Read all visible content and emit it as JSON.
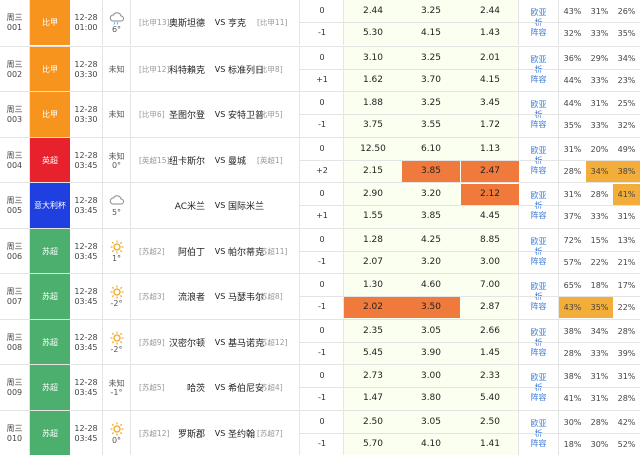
{
  "rows": [
    {
      "day": "周三",
      "num": "001",
      "league": "比甲",
      "color": "#f7941d",
      "date": "12-28",
      "time": "01:00",
      "weather_icon": "cloud-rain-icon",
      "temp": "6°",
      "home_rank": "[比甲13]",
      "home": "奥斯坦德",
      "vs": "VS",
      "away": "亨克",
      "away_rank": "[比甲11]",
      "hc": [
        "0",
        "-1"
      ],
      "odds": [
        [
          "2.44",
          "3.25",
          "2.44"
        ],
        [
          "5.30",
          "4.15",
          "1.43"
        ]
      ],
      "hl_odds": [
        [],
        []
      ],
      "links": [
        "欧",
        "亚",
        "析",
        "阵",
        "容"
      ],
      "pct": [
        [
          "43%",
          "31%",
          "26%"
        ],
        [
          "32%",
          "33%",
          "35%"
        ]
      ],
      "hl_pct": [
        [],
        []
      ]
    },
    {
      "day": "周三",
      "num": "002",
      "league": "比甲",
      "color": "#f7941d",
      "date": "12-28",
      "time": "03:30",
      "weather_icon": "",
      "weather_text": "未知",
      "home_rank": "[比甲12]",
      "home": "科特賴克",
      "vs": "VS",
      "away": "标准列日",
      "away_rank": "[比甲8]",
      "hc": [
        "0",
        "+1"
      ],
      "odds": [
        [
          "3.10",
          "3.25",
          "2.01"
        ],
        [
          "1.62",
          "3.70",
          "4.15"
        ]
      ],
      "hl_odds": [
        [],
        []
      ],
      "links": [
        "欧",
        "亚",
        "析",
        "阵",
        "容"
      ],
      "pct": [
        [
          "36%",
          "29%",
          "34%"
        ],
        [
          "44%",
          "33%",
          "23%"
        ]
      ],
      "hl_pct": [
        [],
        []
      ]
    },
    {
      "day": "周三",
      "num": "003",
      "league": "比甲",
      "color": "#f7941d",
      "date": "12-28",
      "time": "03:30",
      "weather_icon": "",
      "weather_text": "未知",
      "home_rank": "[比甲6]",
      "home": "圣图尔登",
      "vs": "VS",
      "away": "安特卫普",
      "away_rank": "[比甲5]",
      "hc": [
        "0",
        "-1"
      ],
      "odds": [
        [
          "1.88",
          "3.25",
          "3.45"
        ],
        [
          "3.75",
          "3.55",
          "1.72"
        ]
      ],
      "hl_odds": [
        [],
        []
      ],
      "links": [
        "欧",
        "亚",
        "析",
        "阵",
        "容"
      ],
      "pct": [
        [
          "44%",
          "31%",
          "25%"
        ],
        [
          "35%",
          "33%",
          "32%"
        ]
      ],
      "hl_pct": [
        [],
        []
      ]
    },
    {
      "day": "周三",
      "num": "004",
      "league": "英超",
      "color": "#e8222c",
      "date": "12-28",
      "time": "03:45",
      "weather_icon": "",
      "weather_text": "未知",
      "temp": "0°",
      "home_rank": "[英超15]",
      "home": "纽卡斯尔",
      "vs": "VS",
      "away": "曼城",
      "away_rank": "[英超1]",
      "hc": [
        "0",
        "+2"
      ],
      "odds": [
        [
          "12.50",
          "6.10",
          "1.13"
        ],
        [
          "2.15",
          "3.85",
          "2.47"
        ]
      ],
      "hl_odds": [
        [],
        [
          1,
          2
        ]
      ],
      "links": [
        "欧",
        "亚",
        "析",
        "阵",
        "容"
      ],
      "pct": [
        [
          "31%",
          "20%",
          "49%"
        ],
        [
          "28%",
          "34%",
          "38%"
        ]
      ],
      "hl_pct": [
        [],
        [
          1,
          2
        ]
      ]
    },
    {
      "day": "周三",
      "num": "005",
      "league": "意大利杯",
      "color": "#1f3fe0",
      "date": "12-28",
      "time": "03:45",
      "weather_icon": "cloud-icon",
      "temp": "5°",
      "home_rank": "",
      "home": "AC米兰",
      "vs": "VS",
      "away": "国际米兰",
      "away_rank": "",
      "hc": [
        "0",
        "+1"
      ],
      "odds": [
        [
          "2.90",
          "3.20",
          "2.12"
        ],
        [
          "1.55",
          "3.85",
          "4.45"
        ]
      ],
      "hl_odds": [
        [
          2
        ],
        []
      ],
      "links": [
        "欧",
        "亚",
        "析",
        "阵",
        "容"
      ],
      "pct": [
        [
          "31%",
          "28%",
          "41%"
        ],
        [
          "37%",
          "33%",
          "31%"
        ]
      ],
      "hl_pct": [
        [
          2
        ],
        []
      ]
    },
    {
      "day": "周三",
      "num": "006",
      "league": "苏超",
      "color": "#4caf6e",
      "date": "12-28",
      "time": "03:45",
      "weather_icon": "sun-icon",
      "temp": "1°",
      "home_rank": "[苏超2]",
      "home": "阿伯丁",
      "vs": "VS",
      "away": "帕尔蒂克",
      "away_rank": "[苏超11]",
      "hc": [
        "0",
        "-1"
      ],
      "odds": [
        [
          "1.28",
          "4.25",
          "8.85"
        ],
        [
          "2.07",
          "3.20",
          "3.00"
        ]
      ],
      "hl_odds": [
        [],
        []
      ],
      "links": [
        "欧",
        "亚",
        "析",
        "阵",
        "容"
      ],
      "pct": [
        [
          "72%",
          "15%",
          "13%"
        ],
        [
          "57%",
          "22%",
          "21%"
        ]
      ],
      "hl_pct": [
        [],
        []
      ]
    },
    {
      "day": "周三",
      "num": "007",
      "league": "苏超",
      "color": "#4caf6e",
      "date": "12-28",
      "time": "03:45",
      "weather_icon": "sun-icon",
      "temp": "-2°",
      "home_rank": "[苏超3]",
      "home": "流浪者",
      "vs": "VS",
      "away": "马瑟韦尔",
      "away_rank": "[苏超8]",
      "hc": [
        "0",
        "-1"
      ],
      "odds": [
        [
          "1.30",
          "4.60",
          "7.00"
        ],
        [
          "2.02",
          "3.50",
          "2.87"
        ]
      ],
      "hl_odds": [
        [],
        [
          0,
          1
        ]
      ],
      "links": [
        "欧",
        "亚",
        "析",
        "阵",
        "容"
      ],
      "pct": [
        [
          "65%",
          "18%",
          "17%"
        ],
        [
          "43%",
          "35%",
          "22%"
        ]
      ],
      "hl_pct": [
        [],
        [
          0,
          1
        ]
      ]
    },
    {
      "day": "周三",
      "num": "008",
      "league": "苏超",
      "color": "#4caf6e",
      "date": "12-28",
      "time": "03:45",
      "weather_icon": "sun-icon",
      "temp": "-2°",
      "home_rank": "[苏超9]",
      "home": "汉密尔顿",
      "vs": "VS",
      "away": "基马诺克",
      "away_rank": "[苏超12]",
      "hc": [
        "0",
        "-1"
      ],
      "odds": [
        [
          "2.35",
          "3.05",
          "2.66"
        ],
        [
          "5.45",
          "3.90",
          "1.45"
        ]
      ],
      "hl_odds": [
        [],
        []
      ],
      "links": [
        "欧",
        "亚",
        "析",
        "阵",
        "容"
      ],
      "pct": [
        [
          "38%",
          "34%",
          "28%"
        ],
        [
          "28%",
          "33%",
          "39%"
        ]
      ],
      "hl_pct": [
        [],
        []
      ]
    },
    {
      "day": "周三",
      "num": "009",
      "league": "苏超",
      "color": "#4caf6e",
      "date": "12-28",
      "time": "03:45",
      "weather_icon": "",
      "weather_text": "未知",
      "temp": "-1°",
      "home_rank": "[苏超5]",
      "home": "哈茨",
      "vs": "VS",
      "away": "希伯尼安",
      "away_rank": "[苏超4]",
      "hc": [
        "0",
        "-1"
      ],
      "odds": [
        [
          "2.73",
          "3.00",
          "2.33"
        ],
        [
          "1.47",
          "3.80",
          "5.40"
        ]
      ],
      "hl_odds": [
        [],
        []
      ],
      "links": [
        "欧",
        "亚",
        "析",
        "阵",
        "容"
      ],
      "pct": [
        [
          "38%",
          "31%",
          "31%"
        ],
        [
          "41%",
          "31%",
          "28%"
        ]
      ],
      "hl_pct": [
        [],
        []
      ]
    },
    {
      "day": "周三",
      "num": "010",
      "league": "苏超",
      "color": "#4caf6e",
      "date": "12-28",
      "time": "03:45",
      "weather_icon": "sun-icon",
      "temp": "0°",
      "home_rank": "[苏超12]",
      "home": "罗斯郡",
      "vs": "VS",
      "away": "圣约翰",
      "away_rank": "[苏超7]",
      "hc": [
        "0",
        "-1"
      ],
      "odds": [
        [
          "2.50",
          "3.05",
          "2.50"
        ],
        [
          "5.70",
          "4.10",
          "1.41"
        ]
      ],
      "hl_odds": [
        [],
        []
      ],
      "links": [
        "欧",
        "亚",
        "析",
        "阵",
        "容"
      ],
      "pct": [
        [
          "30%",
          "28%",
          "42%"
        ],
        [
          "18%",
          "30%",
          "52%"
        ]
      ],
      "hl_pct": [
        [],
        []
      ]
    }
  ]
}
